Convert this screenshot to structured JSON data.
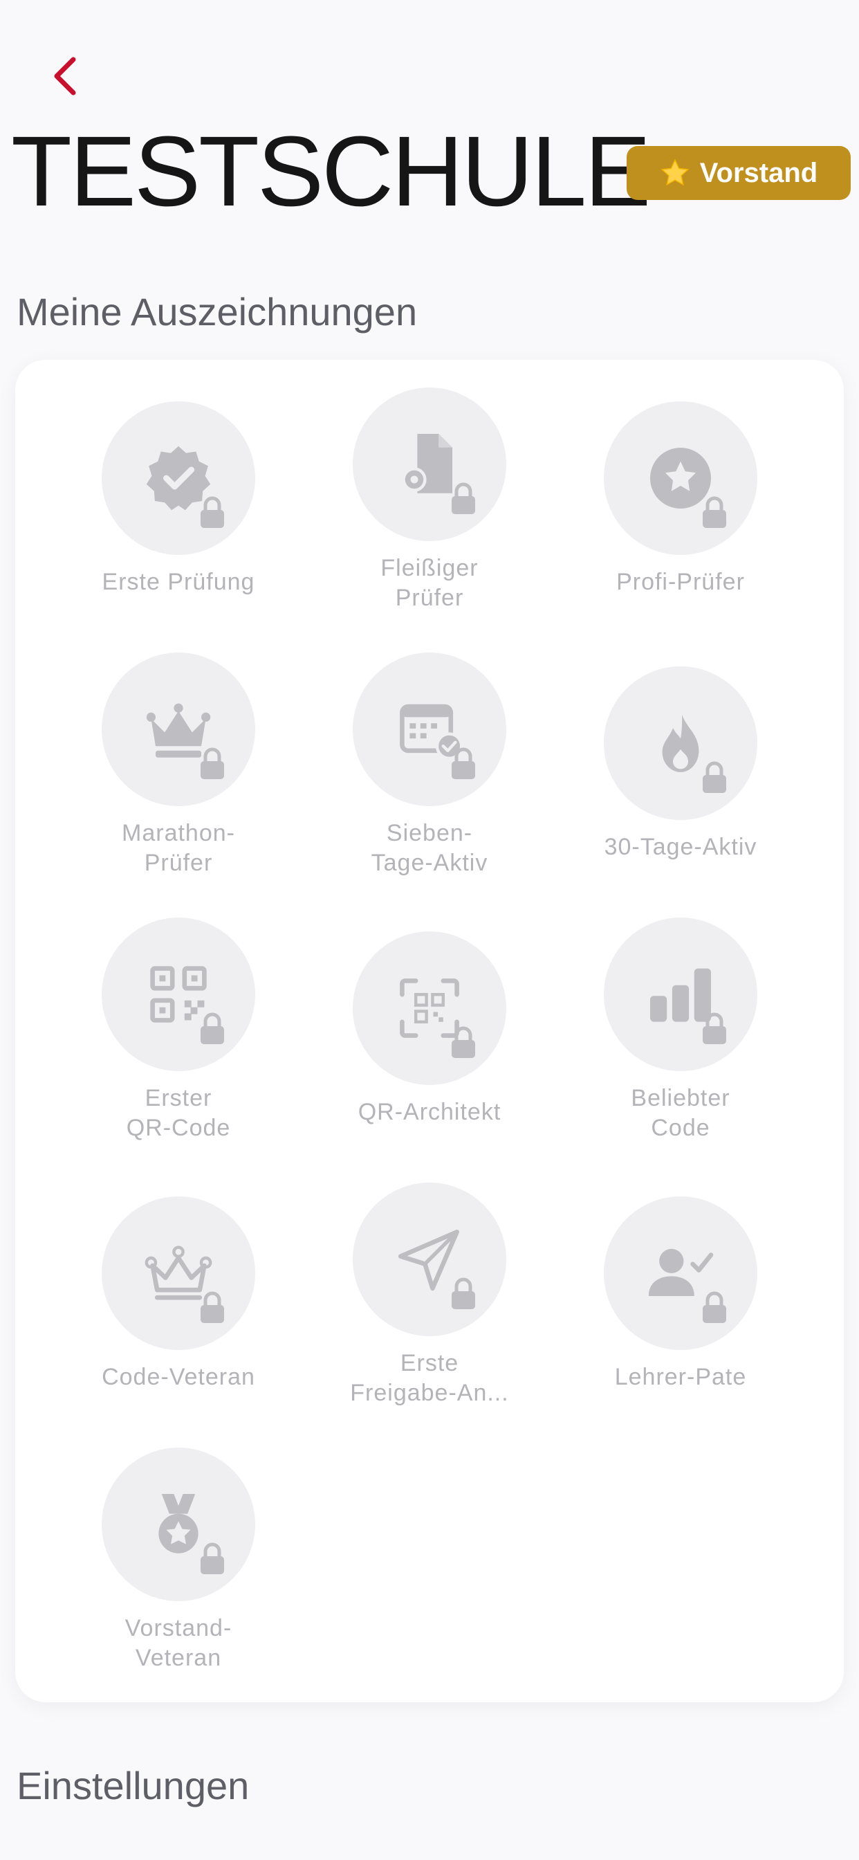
{
  "header": {
    "title": "TESTSCHULE",
    "back_icon": "chevron-left-icon",
    "back_color": "#C8102E"
  },
  "role_badge": {
    "label": "Vorstand",
    "icon": "star-icon",
    "color": "#C0901E"
  },
  "achievements": {
    "section_title": "Meine Auszeichnungen",
    "items": [
      {
        "label": "Erste Prüfung",
        "icon": "verified-seal-icon",
        "locked": true
      },
      {
        "label": "Fleißiger\nPrüfer",
        "icon": "document-gear-icon",
        "locked": true
      },
      {
        "label": "Profi-Prüfer",
        "icon": "star-circle-icon",
        "locked": true
      },
      {
        "label": "Marathon-\nPrüfer",
        "icon": "crown-icon",
        "locked": true
      },
      {
        "label": "Sieben-\nTage-Aktiv",
        "icon": "calendar-check-icon",
        "locked": true
      },
      {
        "label": "30-Tage-Aktiv",
        "icon": "flame-icon",
        "locked": true
      },
      {
        "label": "Erster\nQR-Code",
        "icon": "qr-code-icon",
        "locked": true
      },
      {
        "label": "QR-Architekt",
        "icon": "qr-scan-icon",
        "locked": true
      },
      {
        "label": "Beliebter\nCode",
        "icon": "bar-chart-icon",
        "locked": true
      },
      {
        "label": "Code-Veteran",
        "icon": "crown-outline-icon",
        "locked": true
      },
      {
        "label": "Erste\nFreigabe-An...",
        "icon": "paper-plane-icon",
        "locked": true
      },
      {
        "label": "Lehrer-Pate",
        "icon": "person-check-icon",
        "locked": true
      },
      {
        "label": "Vorstand-\nVeteran",
        "icon": "medal-icon",
        "locked": true
      }
    ]
  },
  "settings": {
    "section_title": "Einstellungen"
  }
}
